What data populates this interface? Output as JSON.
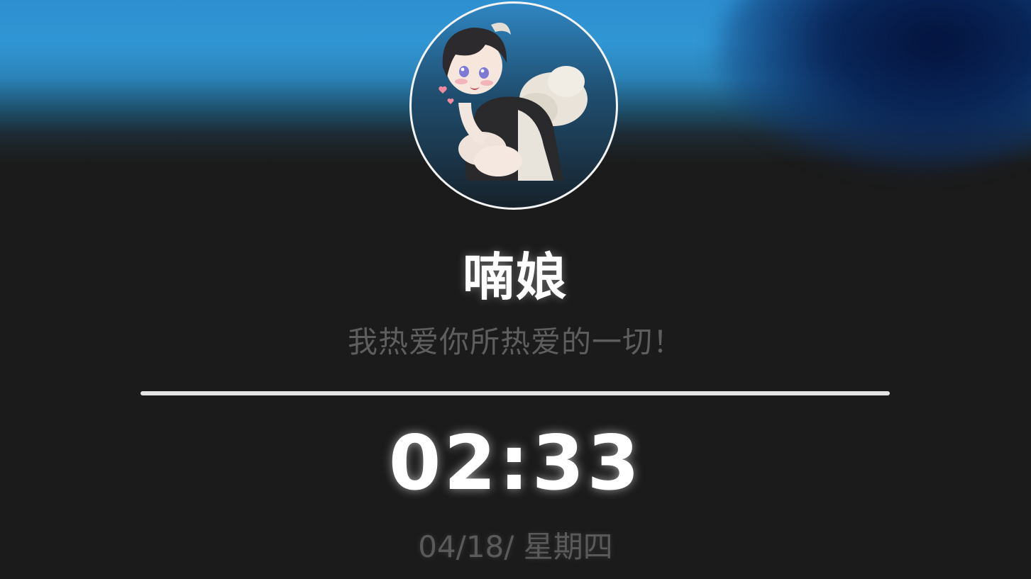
{
  "profile": {
    "name": "喃娘",
    "motto": "我热爱你所热爱的一切！",
    "avatar_icon": "anime-avatar-portrait"
  },
  "clock": {
    "time": "02:33",
    "date": "04/18/ 星期四"
  },
  "colors": {
    "background": "#1b1b1b",
    "sky_blue": "#2d8fd0",
    "divider": "#e4e4e4",
    "name_text": "#ffffff",
    "secondary_text": "#5e5e5e"
  }
}
